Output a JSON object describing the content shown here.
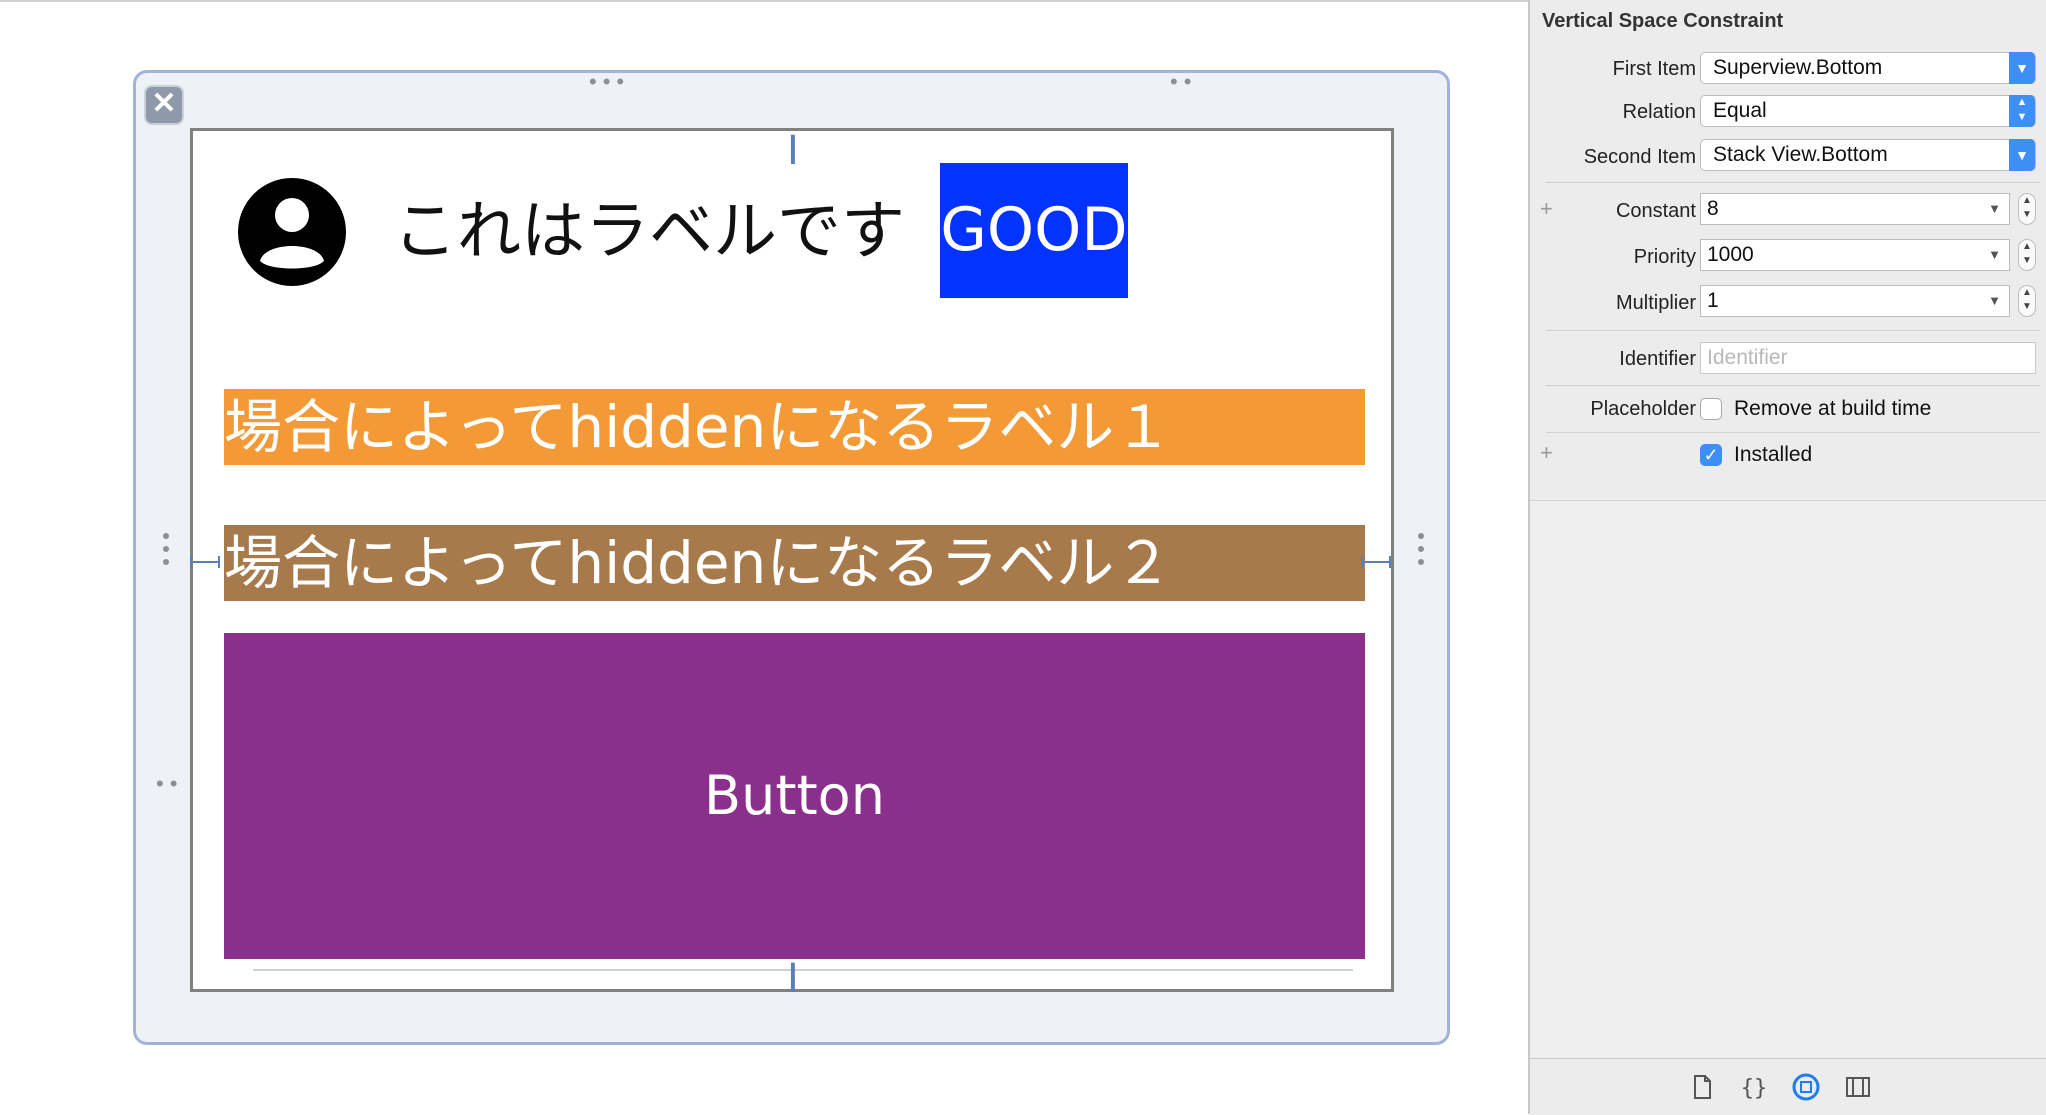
{
  "canvas": {
    "title_label": "これはラベルです",
    "good_label": "GOOD",
    "hidden_label_1": "場合によってhiddenになるラベル１",
    "hidden_label_2": "場合によってhiddenになるラベル２",
    "button_label": "Button"
  },
  "inspector": {
    "title": "Vertical Space Constraint",
    "first_item": {
      "label": "First Item",
      "value": "Superview.Bottom"
    },
    "relation": {
      "label": "Relation",
      "value": "Equal"
    },
    "second_item": {
      "label": "Second Item",
      "value": "Stack View.Bottom"
    },
    "constant": {
      "label": "Constant",
      "value": "8"
    },
    "priority": {
      "label": "Priority",
      "value": "1000"
    },
    "multiplier": {
      "label": "Multiplier",
      "value": "1"
    },
    "identifier": {
      "label": "Identifier",
      "placeholder": "Identifier"
    },
    "placeholder": {
      "label": "Placeholder",
      "checkbox_label": "Remove at build time",
      "checked": false
    },
    "installed": {
      "label": "Installed",
      "checked": true
    }
  },
  "colors": {
    "good_bg": "#0433ff",
    "label1_bg": "#f39a37",
    "label2_bg": "#a77a4b",
    "button_bg": "#8a2f8c",
    "accent": "#3b8ff5"
  },
  "footer_icons": [
    "file-icon",
    "braces-icon",
    "size-inspector-icon",
    "library-icon"
  ]
}
